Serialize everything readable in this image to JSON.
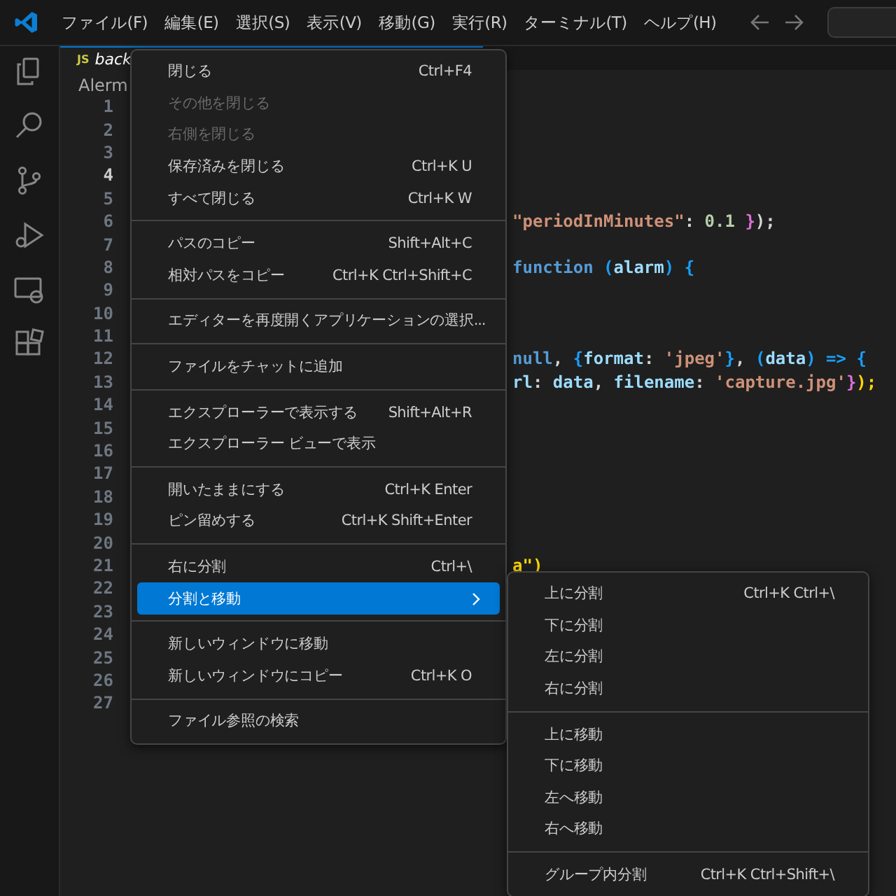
{
  "menu_bar": [
    "ファイル(F)",
    "編集(E)",
    "選択(S)",
    "表示(V)",
    "移動(G)",
    "実行(R)",
    "ターミナル(T)",
    "ヘルプ(H)"
  ],
  "tab": {
    "icon_text": "JS",
    "label": "back"
  },
  "breadcrumb": "Alerm",
  "lines": [
    {
      "number": "1",
      "current": false
    },
    {
      "number": "2",
      "current": false
    },
    {
      "number": "3",
      "current": false
    },
    {
      "number": "4",
      "current": true
    },
    {
      "number": "5",
      "current": false
    },
    {
      "number": "6",
      "current": false,
      "tokens": [
        {
          "text": "\"periodInMinutes\"",
          "kind": "string"
        },
        {
          "text": ": ",
          "kind": "plain"
        },
        {
          "text": "0.1",
          "kind": "number"
        },
        {
          "text": " }",
          "kind": "brace2"
        },
        {
          "text": ");",
          "kind": "plain"
        }
      ]
    },
    {
      "number": "7",
      "current": false
    },
    {
      "number": "8",
      "current": false,
      "tokens": [
        {
          "text": "function",
          "kind": "keyword"
        },
        {
          "text": " (",
          "kind": "brace3"
        },
        {
          "text": "alarm",
          "kind": "variable"
        },
        {
          "text": ") {",
          "kind": "brace3"
        }
      ]
    },
    {
      "number": "9",
      "current": false
    },
    {
      "number": "10",
      "current": false
    },
    {
      "number": "11",
      "current": false
    },
    {
      "number": "12",
      "current": false,
      "tokens": [
        {
          "text": "null",
          "kind": "keyword"
        },
        {
          "text": ", ",
          "kind": "plain"
        },
        {
          "text": "{",
          "kind": "brace3"
        },
        {
          "text": "format",
          "kind": "variable"
        },
        {
          "text": ": ",
          "kind": "plain"
        },
        {
          "text": "'jpeg'",
          "kind": "string"
        },
        {
          "text": "}",
          "kind": "brace3"
        },
        {
          "text": ", ",
          "kind": "plain"
        },
        {
          "text": "(",
          "kind": "brace3"
        },
        {
          "text": "data",
          "kind": "variable"
        },
        {
          "text": ") => {",
          "kind": "brace3"
        }
      ]
    },
    {
      "number": "13",
      "current": false,
      "tokens": [
        {
          "text": "rl",
          "kind": "variable"
        },
        {
          "text": ": ",
          "kind": "plain"
        },
        {
          "text": "data",
          "kind": "variable"
        },
        {
          "text": ", ",
          "kind": "plain"
        },
        {
          "text": "filename",
          "kind": "variable"
        },
        {
          "text": ": ",
          "kind": "plain"
        },
        {
          "text": "'capture.jpg'",
          "kind": "string"
        },
        {
          "text": "}",
          "kind": "brace2"
        },
        {
          "text": ");",
          "kind": "brace1"
        }
      ]
    },
    {
      "number": "14",
      "current": false
    },
    {
      "number": "15",
      "current": false
    },
    {
      "number": "16",
      "current": false
    },
    {
      "number": "17",
      "current": false
    },
    {
      "number": "18",
      "current": false
    },
    {
      "number": "19",
      "current": false
    },
    {
      "number": "20",
      "current": false
    },
    {
      "number": "21",
      "current": false,
      "tokens": [
        {
          "text": "a\")",
          "kind": "brace1"
        }
      ]
    },
    {
      "number": "22",
      "current": false
    },
    {
      "number": "23",
      "current": false
    },
    {
      "number": "24",
      "current": false
    },
    {
      "number": "25",
      "current": false
    },
    {
      "number": "26",
      "current": false
    },
    {
      "number": "27",
      "current": false
    }
  ],
  "context_menu": [
    [
      {
        "label": "閉じる",
        "shortcut": "Ctrl+F4",
        "disabled": false,
        "selected": false
      },
      {
        "label": "その他を閉じる",
        "disabled": true,
        "selected": false
      },
      {
        "label": "右側を閉じる",
        "disabled": true,
        "selected": false
      },
      {
        "label": "保存済みを閉じる",
        "shortcut": "Ctrl+K U",
        "disabled": false,
        "selected": false
      },
      {
        "label": "すべて閉じる",
        "shortcut": "Ctrl+K W",
        "disabled": false,
        "selected": false
      }
    ],
    [
      {
        "label": "パスのコピー",
        "shortcut": "Shift+Alt+C",
        "disabled": false,
        "selected": false
      },
      {
        "label": "相対パスをコピー",
        "shortcut": "Ctrl+K Ctrl+Shift+C",
        "disabled": false,
        "selected": false
      }
    ],
    [
      {
        "label": "エディターを再度開くアプリケーションの選択...",
        "disabled": false,
        "selected": false
      }
    ],
    [
      {
        "label": "ファイルをチャットに追加",
        "disabled": false,
        "selected": false
      }
    ],
    [
      {
        "label": "エクスプローラーで表示する",
        "shortcut": "Shift+Alt+R",
        "disabled": false,
        "selected": false
      },
      {
        "label": "エクスプローラー ビューで表示",
        "disabled": false,
        "selected": false
      }
    ],
    [
      {
        "label": "開いたままにする",
        "shortcut": "Ctrl+K Enter",
        "disabled": false,
        "selected": false
      },
      {
        "label": "ピン留めする",
        "shortcut": "Ctrl+K Shift+Enter",
        "disabled": false,
        "selected": false
      }
    ],
    [
      {
        "label": "右に分割",
        "shortcut": "Ctrl+\\",
        "disabled": false,
        "selected": false
      },
      {
        "label": "分割と移動",
        "submenu": true,
        "disabled": false,
        "selected": true
      }
    ],
    [
      {
        "label": "新しいウィンドウに移動",
        "disabled": false,
        "selected": false
      },
      {
        "label": "新しいウィンドウにコピー",
        "shortcut": "Ctrl+K O",
        "disabled": false,
        "selected": false
      }
    ],
    [
      {
        "label": "ファイル参照の検索",
        "disabled": false,
        "selected": false
      }
    ]
  ],
  "submenu": [
    [
      {
        "label": "上に分割",
        "shortcut": "Ctrl+K Ctrl+\\",
        "disabled": false,
        "selected": false
      },
      {
        "label": "下に分割",
        "disabled": false,
        "selected": false
      },
      {
        "label": "左に分割",
        "disabled": false,
        "selected": false
      },
      {
        "label": "右に分割",
        "disabled": false,
        "selected": false
      }
    ],
    [
      {
        "label": "上に移動",
        "disabled": false,
        "selected": false
      },
      {
        "label": "下に移動",
        "disabled": false,
        "selected": false
      },
      {
        "label": "左へ移動",
        "disabled": false,
        "selected": false
      },
      {
        "label": "右へ移動",
        "disabled": false,
        "selected": false
      }
    ],
    [
      {
        "label": "グループ内分割",
        "shortcut": "Ctrl+K Ctrl+Shift+\\",
        "disabled": false,
        "selected": false
      }
    ]
  ]
}
